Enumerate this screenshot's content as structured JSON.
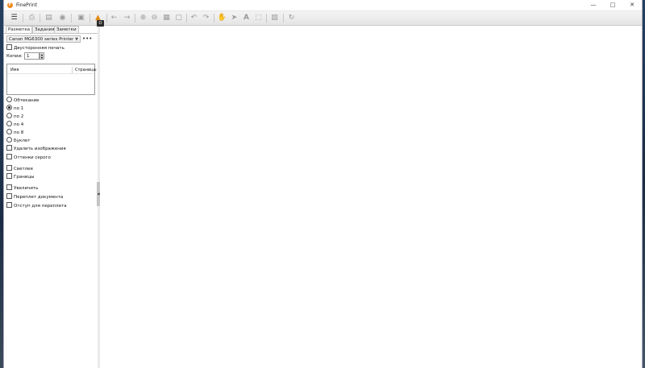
{
  "window": {
    "title": "FinePrint"
  },
  "toolbar": {
    "tooltip": "O"
  },
  "tabs": [
    "Разметка",
    "Задания",
    "Заметки"
  ],
  "printer": {
    "selected": "Canon MG6300 series Printer",
    "more": "•••"
  },
  "duplex_label": "Двусторонняя печать",
  "copies": {
    "label": "Копии:",
    "value": "1"
  },
  "jobs_table": {
    "col_name": "Имя",
    "col_pages": "Страницы"
  },
  "layout_options": [
    {
      "label": "Обтекание",
      "selected": false
    },
    {
      "label": "по 1",
      "selected": true
    },
    {
      "label": "по 2",
      "selected": false
    },
    {
      "label": "по 4",
      "selected": false
    },
    {
      "label": "по 8",
      "selected": false
    },
    {
      "label": "Буклет",
      "selected": false
    }
  ],
  "checkboxes": [
    "Удалить изображения",
    "Оттенки серого",
    "Светлее",
    "Границы",
    "Увеличить",
    "Переплет документа",
    "Отступ для переплета"
  ]
}
